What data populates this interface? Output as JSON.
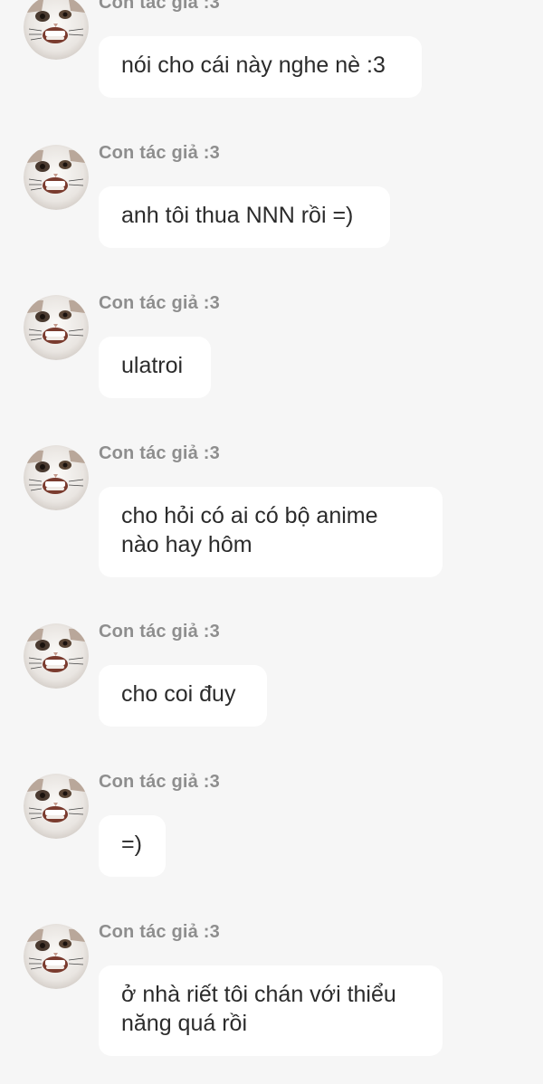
{
  "messages": [
    {
      "author": "Con tác giả :3",
      "text": "nói cho cái này nghe nè :3"
    },
    {
      "author": "Con tác giả :3",
      "text": "anh tôi thua NNN rồi =)"
    },
    {
      "author": "Con tác giả :3",
      "text": "ulatroi"
    },
    {
      "author": "Con tác giả :3",
      "text": "cho hỏi có ai có bộ anime nào hay hôm"
    },
    {
      "author": "Con tác giả :3",
      "text": "cho coi đuy"
    },
    {
      "author": "Con tác giả :3",
      "text": "=)"
    },
    {
      "author": "Con tác giả :3",
      "text": "ở nhà riết tôi chán với thiểu năng quá rồi"
    }
  ]
}
